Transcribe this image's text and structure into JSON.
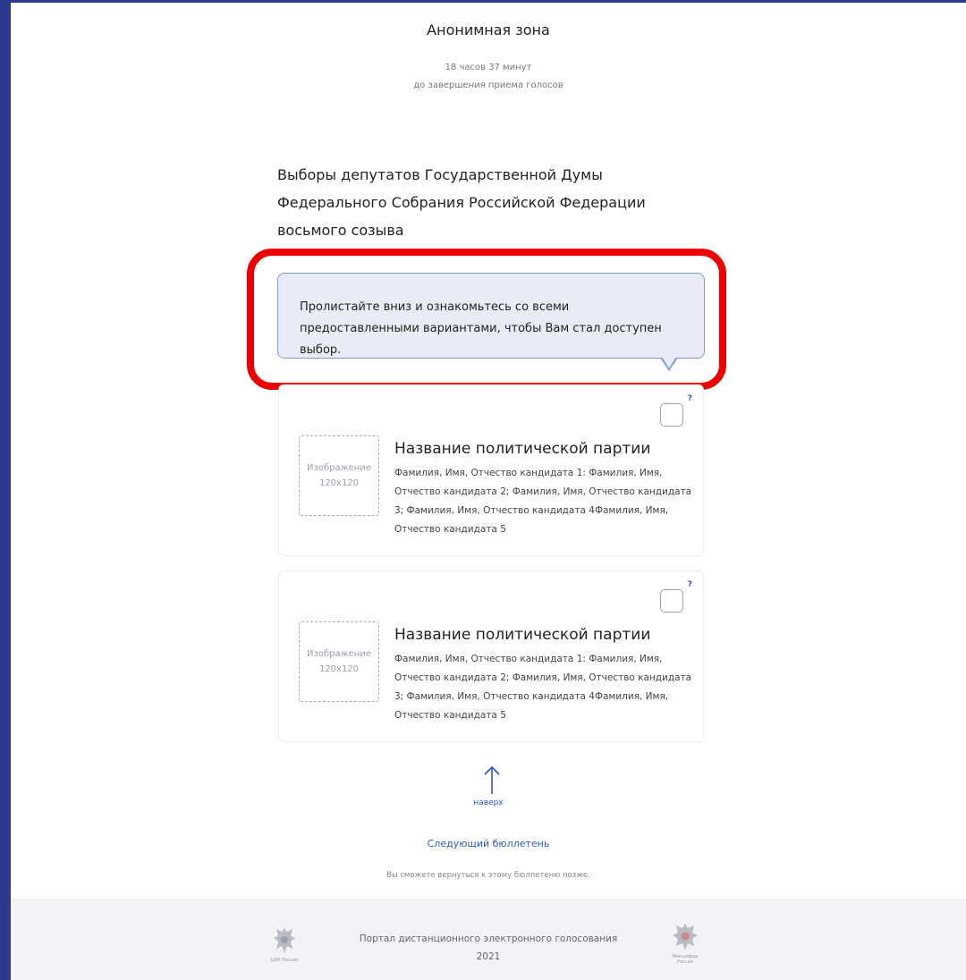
{
  "header": {
    "title": "Анонимная зона",
    "timer": "18 часов 37 минут",
    "timer_caption": "до завершения приема голосов"
  },
  "ballot": {
    "title": "Выборы депутатов Государственной Думы Федерального Собрания Российской Федерации восьмого созыва"
  },
  "tooltip": {
    "text": "Пролистайте вниз и ознакомьтесь со всеми предоставленными вариантами, чтобы Вам стал доступен выбор."
  },
  "cards": [
    {
      "image_label": "Изображение",
      "image_size": "120x120",
      "party_name": "Название политической партии",
      "candidates": "Фамилия, Имя, Отчество кандидата 1: Фамилия, Имя, Отчество кандидата 2; Фамилия, Имя, Отчество кандидата 3; Фамилия, Имя, Отчество кандидата 4Фамилия, Имя, Отчество кандидата 5",
      "help": "?"
    },
    {
      "image_label": "Изображение",
      "image_size": "120x120",
      "party_name": "Название политической партии",
      "candidates": "Фамилия, Имя, Отчество кандидата 1: Фамилия, Имя, Отчество кандидата 2; Фамилия, Имя, Отчество кандидата 3; Фамилия, Имя, Отчество кандидата 4Фамилия, Имя, Отчество кандидата 5",
      "help": "?"
    }
  ],
  "navigation": {
    "up_label": "наверх",
    "next_ballot": "Следующий бюллетень",
    "return_note": "Вы сможете вернуться к этому бюллетеню позже."
  },
  "footer": {
    "portal": "Портал дистанционного электронного голосования",
    "year": "2021",
    "left_caption": "ЦИК России",
    "right_caption": "Минцифры России"
  },
  "colors": {
    "frame": "#2b3990",
    "accent": "#2b56c6",
    "highlight": "#ee0000",
    "tooltip_bg": "#e7ecf6"
  }
}
